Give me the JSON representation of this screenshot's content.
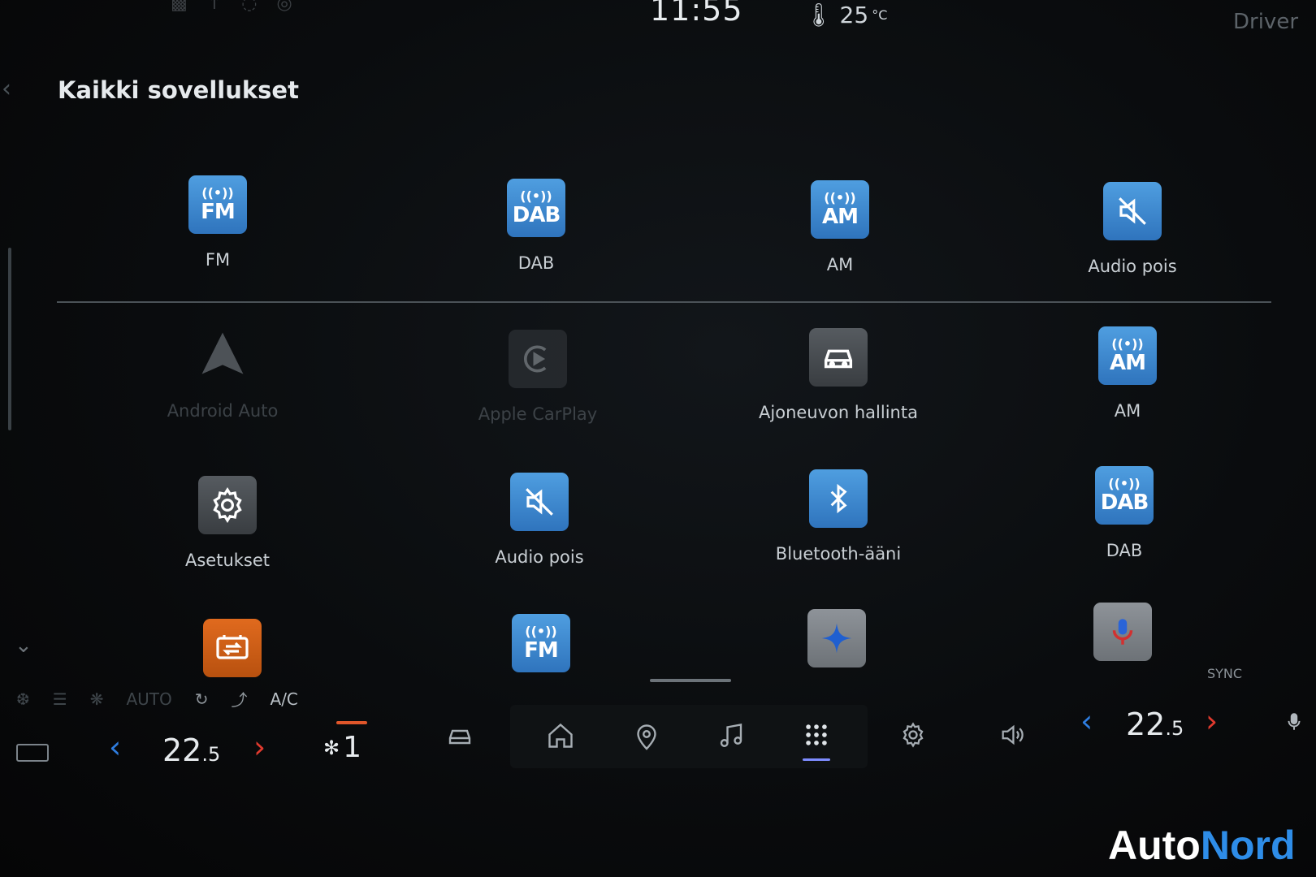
{
  "status": {
    "clock": "11:55",
    "temperature": "25",
    "temperature_unit": "°C",
    "profile": "Driver"
  },
  "page": {
    "title": "Kaikki sovellukset"
  },
  "apps": [
    {
      "name": "fm",
      "label": "FM",
      "badge": "FM",
      "style": "blue"
    },
    {
      "name": "dab",
      "label": "DAB",
      "badge": "DAB",
      "style": "blue"
    },
    {
      "name": "am",
      "label": "AM",
      "badge": "AM",
      "style": "blue"
    },
    {
      "name": "audio-off",
      "label": "Audio pois",
      "style": "blue"
    },
    {
      "name": "android-auto",
      "label": "Android Auto",
      "style": "dim"
    },
    {
      "name": "apple-carplay",
      "label": "Apple CarPlay",
      "style": "dim"
    },
    {
      "name": "vehicle-control",
      "label": "Ajoneuvon hallinta",
      "style": "gray"
    },
    {
      "name": "am-2",
      "label": "AM",
      "badge": "AM",
      "style": "blue"
    },
    {
      "name": "settings",
      "label": "Asetukset",
      "style": "gray"
    },
    {
      "name": "audio-off-2",
      "label": "Audio pois",
      "style": "blue"
    },
    {
      "name": "bluetooth-audio",
      "label": "Bluetooth-ääni",
      "style": "blue"
    },
    {
      "name": "dab-2",
      "label": "DAB",
      "badge": "DAB",
      "style": "blue"
    },
    {
      "name": "battery",
      "label": "",
      "style": "orange"
    },
    {
      "name": "fm-2",
      "label": "",
      "badge": "FM",
      "style": "blue"
    },
    {
      "name": "assistant",
      "label": "",
      "style": "light"
    },
    {
      "name": "voice",
      "label": "",
      "style": "light"
    }
  ],
  "climate": {
    "auto_label": "AUTO",
    "ac_label": "A/C",
    "sync_label": "SYNC",
    "left_temp": "22",
    "left_temp_decimal": ".5",
    "right_temp": "22",
    "right_temp_decimal": ".5",
    "fan_level": "1"
  },
  "nav": [
    "car",
    "home",
    "map-pin",
    "music",
    "apps",
    "settings",
    "volume"
  ],
  "brand": {
    "part1": "Auto",
    "part2": "Nord"
  },
  "colors": {
    "accent_blue": "#2e8de8",
    "temp_down": "#2e7de0",
    "temp_up": "#e03a2e",
    "fan_bar": "#e0562a"
  }
}
